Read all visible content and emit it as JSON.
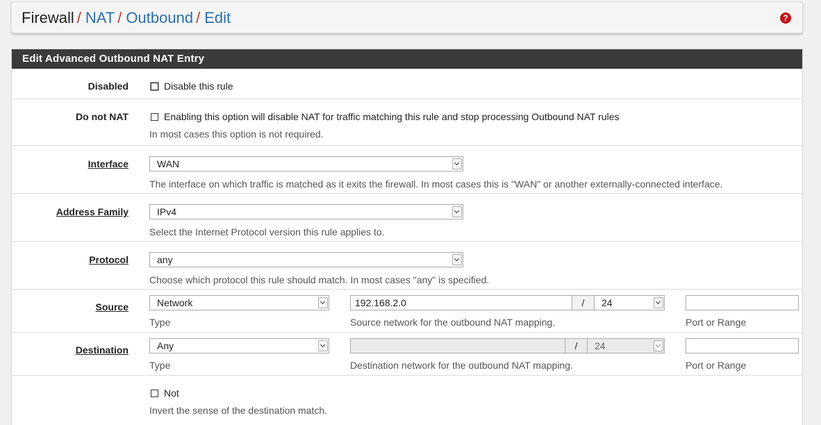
{
  "breadcrumb": {
    "items": [
      "Firewall",
      "NAT",
      "Outbound",
      "Edit"
    ],
    "separator": "/"
  },
  "help_icon": "question-circle-icon",
  "panel": {
    "title": "Edit Advanced Outbound NAT Entry"
  },
  "disabled": {
    "label": "Disabled",
    "checkbox_text": "Disable this rule",
    "checked": false
  },
  "nonat": {
    "label": "Do not NAT",
    "checkbox_text": "Enabling this option will disable NAT for traffic matching this rule and stop processing Outbound NAT rules",
    "help": "In most cases this option is not required.",
    "checked": false
  },
  "interface": {
    "label": "Interface",
    "value": "WAN",
    "help": "The interface on which traffic is matched as it exits the firewall. In most cases this is \"WAN\" or another externally-connected interface."
  },
  "address_family": {
    "label": "Address Family",
    "value": "IPv4",
    "help": "Select the Internet Protocol version this rule applies to."
  },
  "protocol": {
    "label": "Protocol",
    "value": "any",
    "help": "Choose which protocol this rule should match. In most cases \"any\" is specified."
  },
  "source": {
    "label": "Source",
    "type_value": "Network",
    "type_help": "Type",
    "network_value": "192.168.2.0",
    "mask_sep": "/",
    "mask_value": "24",
    "network_help": "Source network for the outbound NAT mapping.",
    "port_value": "",
    "port_help": "Port or Range"
  },
  "destination": {
    "label": "Destination",
    "type_value": "Any",
    "type_help": "Type",
    "network_value": "",
    "mask_sep": "/",
    "mask_value": "24",
    "network_help": "Destination network for the outbound NAT mapping.",
    "port_value": "",
    "port_help": "Port or Range"
  },
  "invert": {
    "checkbox_text": "Not",
    "help": "Invert the sense of the destination match.",
    "checked": false
  },
  "colors": {
    "link": "#2a6fb0",
    "separator": "#c0392b",
    "heading_bg": "#3b3b3b",
    "help_icon": "#c0141a"
  }
}
